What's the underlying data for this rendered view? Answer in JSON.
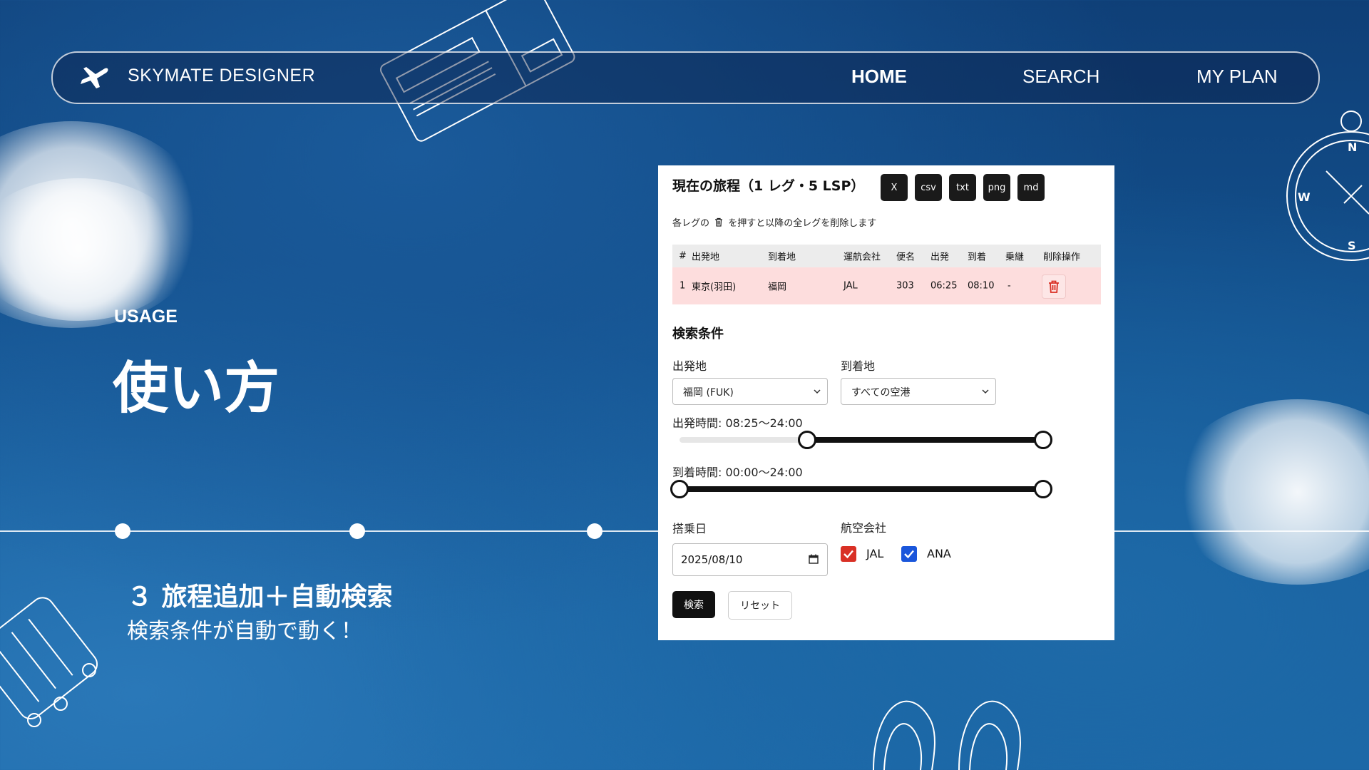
{
  "nav": {
    "brand": "SKYMATE DESIGNER",
    "links": [
      "HOME",
      "SEARCH",
      "MY PLAN"
    ]
  },
  "hero": {
    "eyebrow": "USAGE",
    "title": "使い方",
    "step_title": "３ 旅程追加＋自動検索",
    "step_sub": "検索条件が自動で動く！"
  },
  "panel": {
    "title": "現在の旅程（1 レグ・5 LSP）",
    "export_buttons": [
      "X",
      "csv",
      "txt",
      "png",
      "md"
    ],
    "note_prefix": "各レグの",
    "note_suffix": "を押すと以降の全レグを削除します",
    "table": {
      "headers": [
        "#",
        "出発地",
        "到着地",
        "運航会社",
        "便名",
        "出発",
        "到着",
        "乗継",
        "削除操作"
      ],
      "rows": [
        [
          "1",
          "東京(羽田)",
          "福岡",
          "JAL",
          "303",
          "06:25",
          "08:10",
          "-"
        ]
      ]
    },
    "search": {
      "section_title": "検索条件",
      "origin_label": "出発地",
      "origin_value": "福岡 (FUK)",
      "dest_label": "到着地",
      "dest_value": "すべての空港",
      "dep_time_label": "出発時間: 08:25〜24:00",
      "dep_range_fraction": [
        0.351,
        1.0
      ],
      "arr_time_label": "到着時間: 00:00〜24:00",
      "arr_range_fraction": [
        0.0,
        1.0
      ],
      "date_label": "搭乗日",
      "date_value": "2025/08/10",
      "airline_label": "航空会社",
      "airlines": [
        {
          "name": "JAL",
          "checked": true,
          "color": "#d93025"
        },
        {
          "name": "ANA",
          "checked": true,
          "color": "#1a56db"
        }
      ],
      "search_button": "検索",
      "reset_button": "リセット"
    }
  },
  "colors": {
    "row_highlight": "#fddddd",
    "delete_icon": "#d93025",
    "dark_button": "#1a1a1a"
  }
}
